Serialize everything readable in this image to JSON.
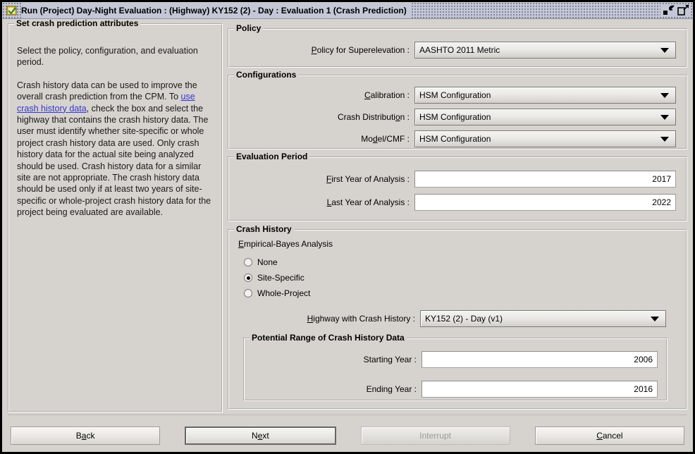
{
  "window": {
    "title": "Run (Project) Day-Night Evaluation : (Highway) KY152 (2) - Day : Evaluation 1 (Crash Prediction)",
    "icon": "document-check-icon",
    "restore_icon": "restore-window-icon",
    "maximize_icon": "maximize-window-icon"
  },
  "left_panel": {
    "title": "Set crash prediction attributes",
    "paragraph_1": "Select the policy, configuration, and evaluation period.",
    "paragraph_2_pre": "Crash history data can be used to improve the overall crash prediction from the CPM. To ",
    "paragraph_2_link": "use crash history data",
    "paragraph_2_post": ", check the box and select the highway that contains the crash history data. The user must identify whether site-specific or whole project crash history data are used. Only crash history data for the actual site being analyzed should be used. Crash history data for a similar site are not appropriate. The crash history data should be used only if at least two years of site-specific or whole-project crash history data for the project being evaluated are available.",
    "link_color": "#3636cf"
  },
  "policy": {
    "title": "Policy",
    "superelevation_label": "Policy for Superelevation :",
    "superelevation_label_mnemonic": "P",
    "superelevation_value": "AASHTO 2011 Metric"
  },
  "configurations": {
    "title": "Configurations",
    "rows": [
      {
        "label_pre": "",
        "label_mnemonic": "C",
        "label_post": "alibration :",
        "value": "HSM Configuration"
      },
      {
        "label_pre": "Crash Distributi",
        "label_mnemonic": "o",
        "label_post": "n :",
        "value": "HSM Configuration"
      },
      {
        "label_pre": "Mo",
        "label_mnemonic": "d",
        "label_post": "el/CMF :",
        "value": "HSM Configuration"
      }
    ]
  },
  "evaluation_period": {
    "title": "Evaluation Period",
    "first_year_label_mnemonic": "F",
    "first_year_label_post": "irst Year of Analysis :",
    "first_year_value": "2017",
    "last_year_label_mnemonic": "L",
    "last_year_label_post": "ast Year of Analysis :",
    "last_year_value": "2022"
  },
  "crash_history": {
    "title": "Crash History",
    "eb_label_mnemonic": "E",
    "eb_label_post": "mpirical-Bayes Analysis",
    "options": [
      {
        "label": "None",
        "selected": false
      },
      {
        "label": "Site-Specific",
        "selected": true
      },
      {
        "label": "Whole-Project",
        "selected": false
      }
    ],
    "highway_label_mnemonic": "H",
    "highway_label_post": "ighway with Crash History :",
    "highway_value": "KY152 (2) - Day (v1)",
    "range": {
      "title": "Potential Range of Crash History Data",
      "starting_year_label": "Starting Year :",
      "starting_year_value": "2006",
      "ending_year_label": "Ending Year :",
      "ending_year_value": "2016"
    }
  },
  "buttons": {
    "back": {
      "pre": "B",
      "mnemonic": "a",
      "post": "ck"
    },
    "next": {
      "pre": "N",
      "mnemonic": "e",
      "post": "xt"
    },
    "interrupt": {
      "label": "Interrupt",
      "disabled": true
    },
    "cancel": {
      "pre": "",
      "mnemonic": "C",
      "post": "ancel"
    }
  }
}
